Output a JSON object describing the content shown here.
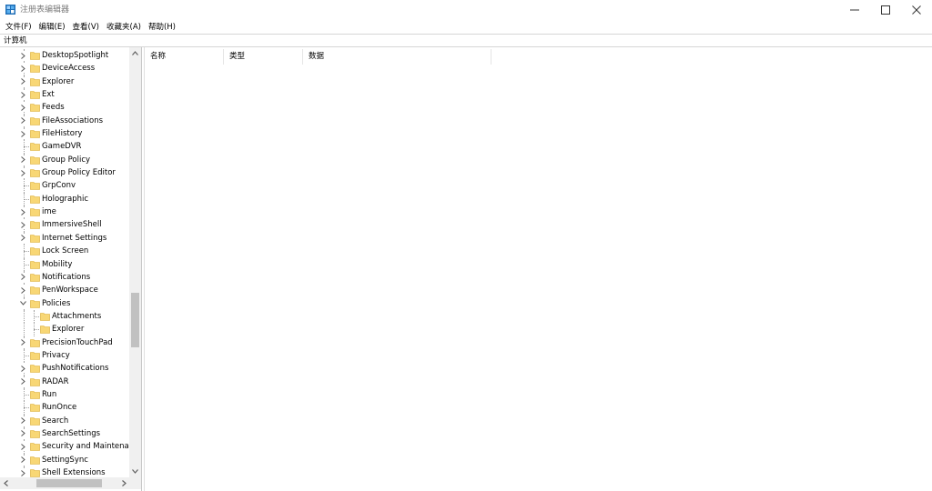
{
  "window": {
    "title": "注册表编辑器",
    "minimize_glyph": "minimize-icon",
    "maximize_glyph": "maximize-icon",
    "close_glyph": "close-icon"
  },
  "menu": [
    "文件(F)",
    "编辑(E)",
    "查看(V)",
    "收藏夹(A)",
    "帮助(H)"
  ],
  "address": "计算机",
  "tree": [
    {
      "label": "DesktopSpotlight",
      "level": 0,
      "expander": "collapsed"
    },
    {
      "label": "DeviceAccess",
      "level": 0,
      "expander": "collapsed"
    },
    {
      "label": "Explorer",
      "level": 0,
      "expander": "collapsed"
    },
    {
      "label": "Ext",
      "level": 0,
      "expander": "collapsed"
    },
    {
      "label": "Feeds",
      "level": 0,
      "expander": "collapsed"
    },
    {
      "label": "FileAssociations",
      "level": 0,
      "expander": "collapsed"
    },
    {
      "label": "FileHistory",
      "level": 0,
      "expander": "collapsed"
    },
    {
      "label": "GameDVR",
      "level": 0,
      "expander": "none"
    },
    {
      "label": "Group Policy",
      "level": 0,
      "expander": "collapsed"
    },
    {
      "label": "Group Policy Editor",
      "level": 0,
      "expander": "collapsed"
    },
    {
      "label": "GrpConv",
      "level": 0,
      "expander": "none"
    },
    {
      "label": "Holographic",
      "level": 0,
      "expander": "none"
    },
    {
      "label": "ime",
      "level": 0,
      "expander": "collapsed"
    },
    {
      "label": "ImmersiveShell",
      "level": 0,
      "expander": "collapsed"
    },
    {
      "label": "Internet Settings",
      "level": 0,
      "expander": "collapsed"
    },
    {
      "label": "Lock Screen",
      "level": 0,
      "expander": "none"
    },
    {
      "label": "Mobility",
      "level": 0,
      "expander": "none"
    },
    {
      "label": "Notifications",
      "level": 0,
      "expander": "collapsed"
    },
    {
      "label": "PenWorkspace",
      "level": 0,
      "expander": "collapsed"
    },
    {
      "label": "Policies",
      "level": 0,
      "expander": "expanded"
    },
    {
      "label": "Attachments",
      "level": 1,
      "expander": "none"
    },
    {
      "label": "Explorer",
      "level": 1,
      "expander": "none"
    },
    {
      "label": "PrecisionTouchPad",
      "level": 0,
      "expander": "collapsed"
    },
    {
      "label": "Privacy",
      "level": 0,
      "expander": "none"
    },
    {
      "label": "PushNotifications",
      "level": 0,
      "expander": "collapsed"
    },
    {
      "label": "RADAR",
      "level": 0,
      "expander": "collapsed"
    },
    {
      "label": "Run",
      "level": 0,
      "expander": "none"
    },
    {
      "label": "RunOnce",
      "level": 0,
      "expander": "none"
    },
    {
      "label": "Search",
      "level": 0,
      "expander": "collapsed"
    },
    {
      "label": "SearchSettings",
      "level": 0,
      "expander": "collapsed"
    },
    {
      "label": "Security and Maintenar",
      "level": 0,
      "expander": "collapsed"
    },
    {
      "label": "SettingSync",
      "level": 0,
      "expander": "collapsed"
    },
    {
      "label": "Shell Extensions",
      "level": 0,
      "expander": "collapsed"
    }
  ],
  "columns": [
    "名称",
    "类型",
    "数据"
  ],
  "colors": {
    "folder_fill": "#f8d775",
    "folder_edge": "#d9a92e",
    "scroll_track": "#f0f0f0",
    "scroll_thumb": "#c1c1c1"
  }
}
